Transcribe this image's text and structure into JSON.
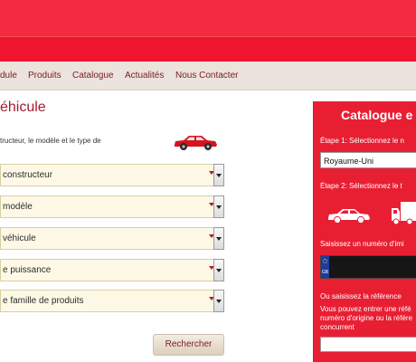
{
  "nav": {
    "items": [
      "dule",
      "Produits",
      "Catalogue",
      "Actualités",
      "Nous Contacter"
    ]
  },
  "main": {
    "title": "éhicule",
    "intro": "tructeur, le modèle et le type de",
    "selects": [
      {
        "value": "constructeur"
      },
      {
        "value": "modèle"
      },
      {
        "value": "véhicule"
      },
      {
        "value": "e puissance"
      },
      {
        "value": "e famille de produits"
      }
    ],
    "search_label": "Rechercher"
  },
  "panel": {
    "title": "Catalogue e",
    "step1": "Étape 1: Sélectionnez le n",
    "country": "Royaume-Uni",
    "step2": "Étape 2: Sélectionnez le t",
    "plate_prompt": "Saisissez un numéro d'imi",
    "plate_country_code": "GB",
    "ref_prompt": "Ou saisissez la référence",
    "ref_help_1": "Vous pouvez entrer une réfé",
    "ref_help_2": "numéro d'origine ou la référe",
    "ref_help_3": "concurrent"
  },
  "colors": {
    "brand_red": "#f0142e",
    "panel_red": "#e81f33",
    "nav_bg": "#ebe3dc",
    "title_red": "#a51c30"
  }
}
